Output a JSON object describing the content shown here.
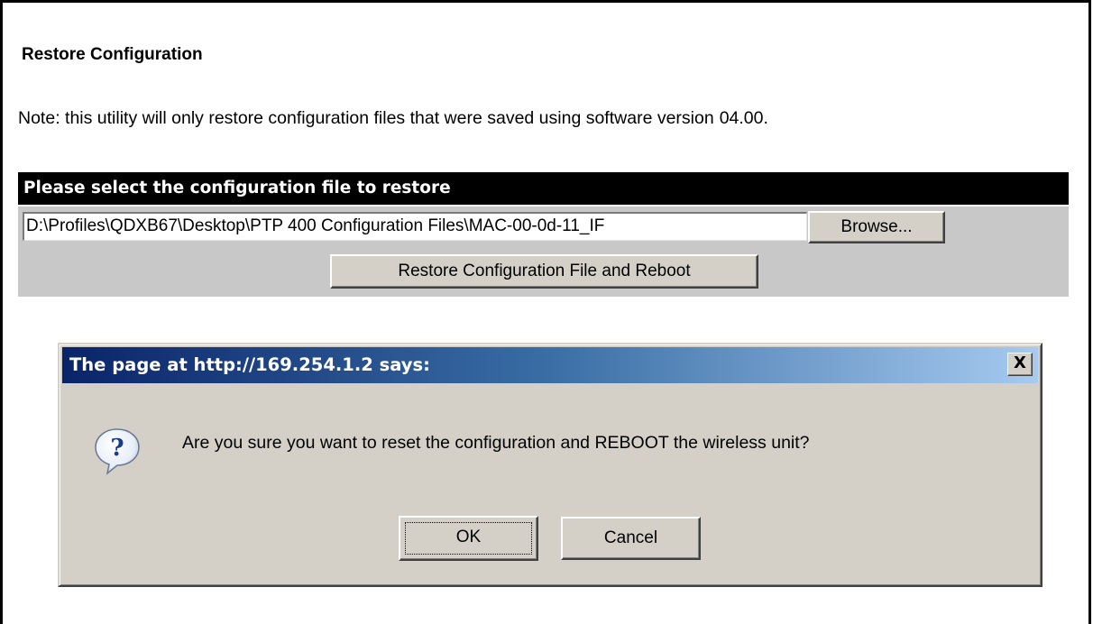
{
  "page": {
    "title": "Restore Configuration",
    "note": "Note: this utility will only restore configuration files that were saved using software version",
    "version": "04.00."
  },
  "panel": {
    "header": "Please select the configuration file to restore",
    "file_path": "D:\\Profiles\\QDXB67\\Desktop\\PTP 400 Configuration Files\\MAC-00-0d-11_IF",
    "browse_label": "Browse...",
    "restore_label": "Restore Configuration File and Reboot"
  },
  "dialog": {
    "title": "The page at http://169.254.1.2 says:",
    "close_label": "X",
    "message": "Are you sure you want to reset the configuration and REBOOT the wireless unit?",
    "ok_label": "OK",
    "cancel_label": "Cancel",
    "icon": "question-icon"
  }
}
